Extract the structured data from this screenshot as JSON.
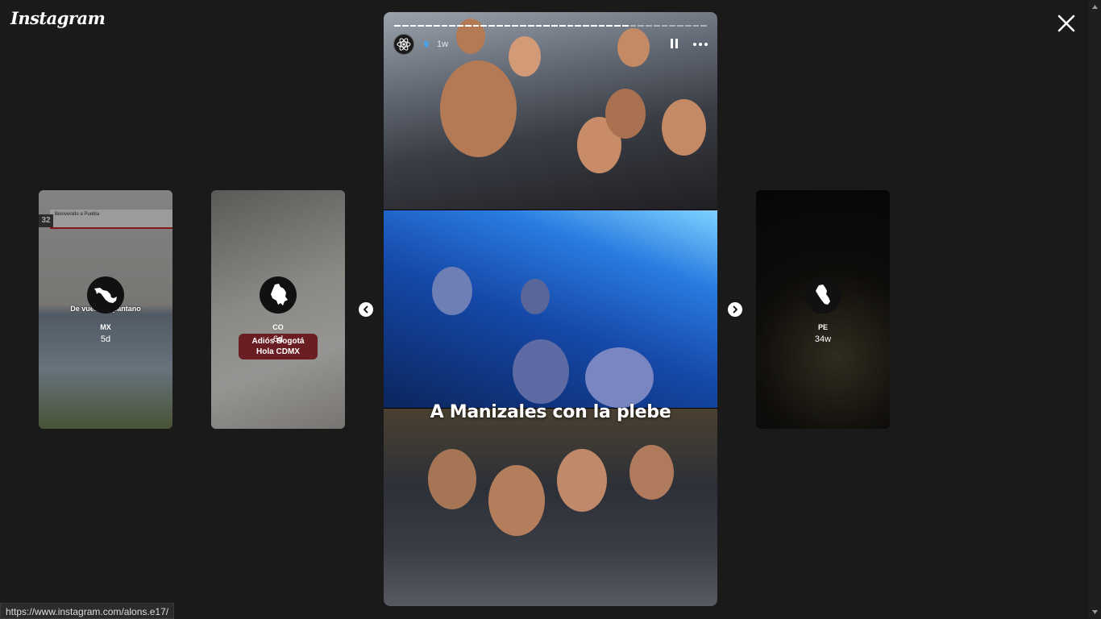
{
  "app": {
    "logo": "Instagram"
  },
  "previews": [
    {
      "id": "mx",
      "username": "MX",
      "age": "5d",
      "caption": "De vuelta al pantano",
      "station_sign": "Bienvenido a Puebla",
      "station_number": "32"
    },
    {
      "id": "co",
      "username": "CO",
      "age": "6d",
      "caption_lines": [
        "Adiós Bogotá",
        "Hola CDMX"
      ]
    },
    {
      "id": "pe",
      "username": "PE",
      "age": "34w"
    }
  ],
  "story": {
    "time": "1w",
    "caption": "A Manizales con la plebe",
    "progress_segments_total": 40,
    "progress_segments_done": 30
  },
  "status_bar": {
    "url": "https://www.instagram.com/alons.e17/"
  },
  "icons": {
    "close": "close-icon",
    "prev": "chevron-left-icon",
    "next": "chevron-right-icon",
    "pause": "pause-icon",
    "more": "more-horizontal-icon"
  }
}
